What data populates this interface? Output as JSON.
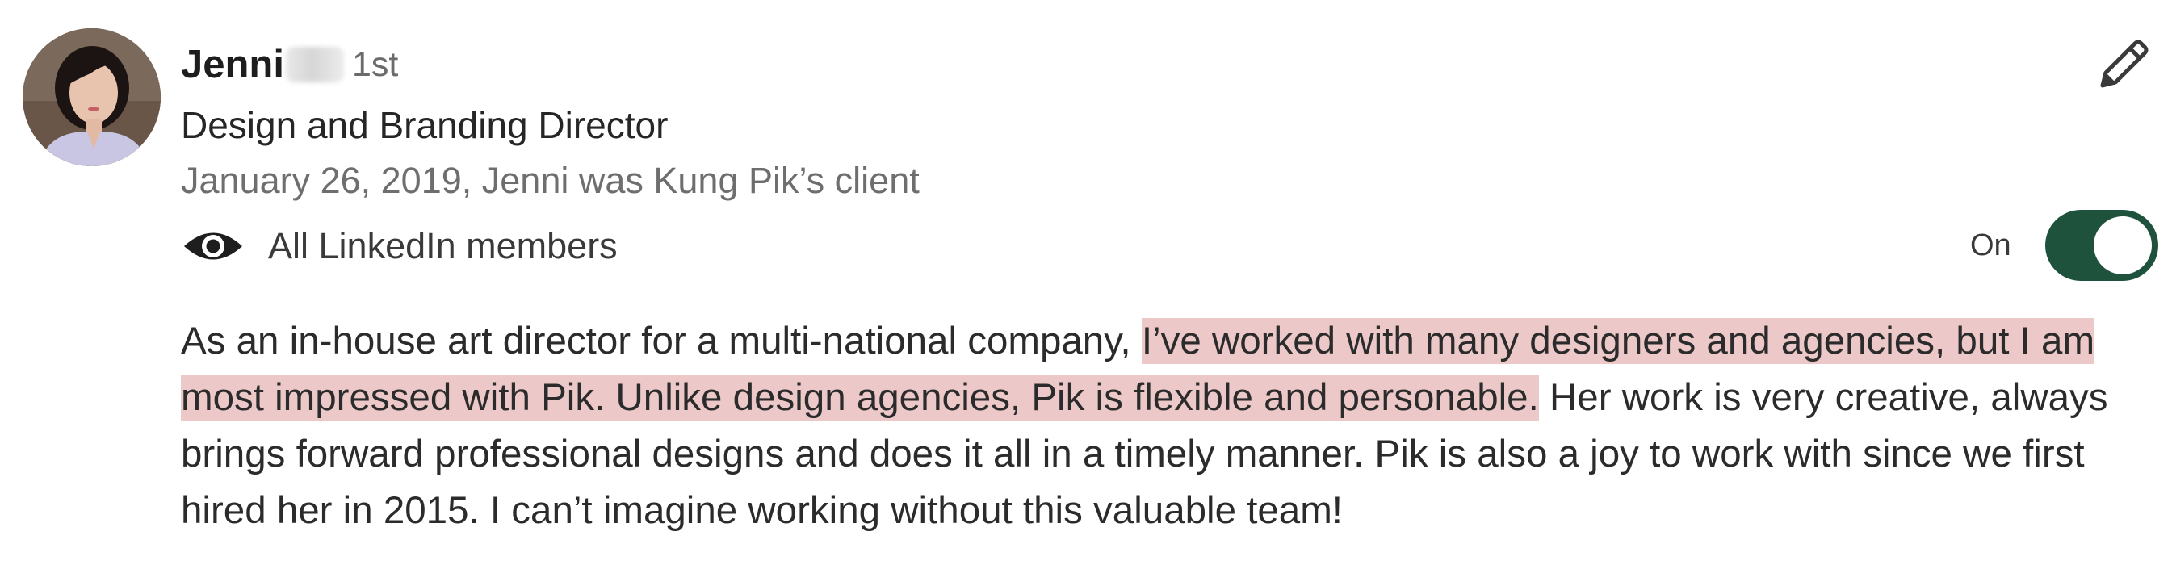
{
  "recommender": {
    "name": "Jenni",
    "degree": "1st",
    "headline": "Design and Branding Director",
    "meta": "January 26, 2019, Jenni was Kung Pik’s client",
    "avatar_icon": "profile-photo"
  },
  "visibility": {
    "icon": "eye-icon",
    "label": "All LinkedIn members",
    "toggle_label": "On",
    "toggle_on": true,
    "toggle_color": "#1f523d"
  },
  "actions": {
    "edit_icon": "pencil-icon"
  },
  "recommendation": {
    "line1_plain": "As an in-house art director for a multi-national company, ",
    "line1_highlight": "I’ve worked with many designers and agencies, but I am",
    "line2_highlight": "most impressed with Pik. Unlike design agencies, Pik is flexible and personable.",
    "line2_plain": " Her work is very creative, always",
    "line3": "brings forward professional designs and does it all in a timely manner. Pik is also a joy to work with since we first",
    "line4": "hired her in 2015. I can’t imagine working without this valuable team!",
    "highlight_color": "#ecc8c8"
  }
}
